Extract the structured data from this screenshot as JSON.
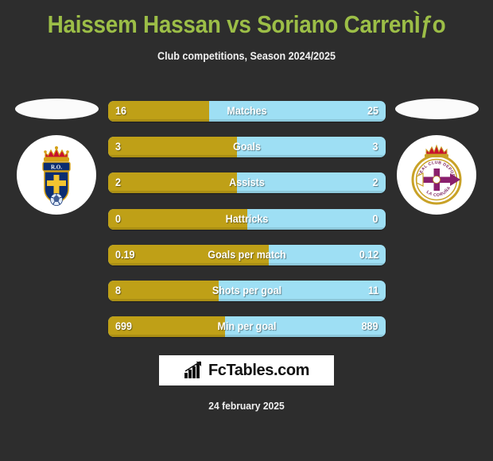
{
  "header": {
    "title": "Haissem Hassan vs Soriano CarrenÌƒo",
    "subtitle": "Club competitions, Season 2024/2025"
  },
  "teams": {
    "left": {
      "name": "Real Oviedo",
      "crest_icon": "real-oviedo-crest",
      "bar_color": "#bfa017"
    },
    "right": {
      "name": "Deportivo La Coruna",
      "crest_icon": "deportivo-la-coruna-crest",
      "bar_color": "#9edff4"
    }
  },
  "stats": [
    {
      "label": "Matches",
      "left": "16",
      "right": "25",
      "left_pct": 36.5
    },
    {
      "label": "Goals",
      "left": "3",
      "right": "3",
      "left_pct": 46.5
    },
    {
      "label": "Assists",
      "left": "2",
      "right": "2",
      "left_pct": 46.5
    },
    {
      "label": "Hattricks",
      "left": "0",
      "right": "0",
      "left_pct": 50.0
    },
    {
      "label": "Goals per match",
      "left": "0.19",
      "right": "0.12",
      "left_pct": 57.9
    },
    {
      "label": "Shots per goal",
      "left": "8",
      "right": "11",
      "left_pct": 39.8
    },
    {
      "label": "Min per goal",
      "left": "699",
      "right": "889",
      "left_pct": 42.1
    }
  ],
  "footer": {
    "logo_icon": "bar-chart-arrow-icon",
    "logo_text": "FcTables.com",
    "date": "24 february 2025"
  },
  "colors": {
    "background": "#2d2d2d",
    "title": "#9cbe47",
    "left_bar": "#bfa017",
    "right_bar": "#9edff4",
    "text": "#ffffff"
  }
}
